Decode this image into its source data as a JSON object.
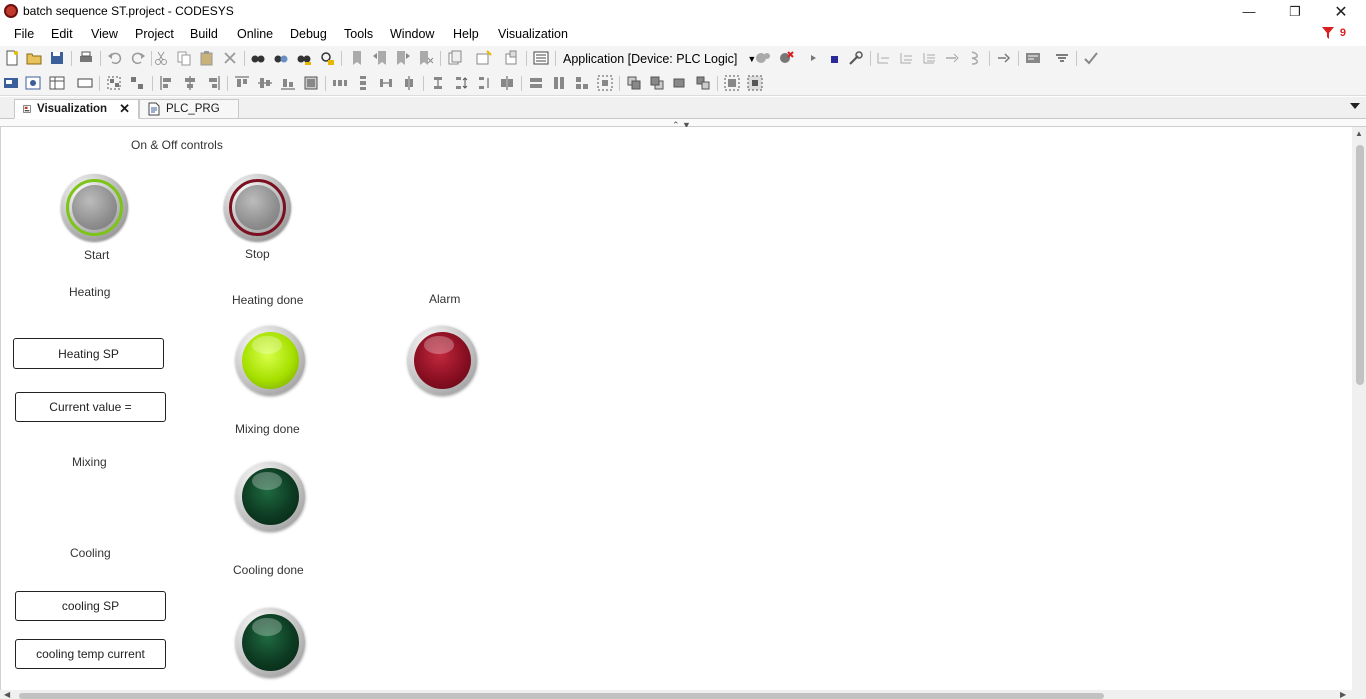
{
  "window": {
    "title": "batch sequence ST.project - CODESYS"
  },
  "menu": [
    "File",
    "Edit",
    "View",
    "Project",
    "Build",
    "Online",
    "Debug",
    "Tools",
    "Window",
    "Help",
    "Visualization"
  ],
  "alerts": {
    "count": "9"
  },
  "toolbar": {
    "application_combo": "Application [Device: PLC Logic]"
  },
  "tabs": [
    {
      "label": "Visualization",
      "active": true
    },
    {
      "label": "PLC_PRG",
      "active": false
    }
  ],
  "canvas": {
    "section_title": "On & Off controls",
    "start_label": "Start",
    "stop_label": "Stop",
    "heating_label": "Heating",
    "heating_sp": "Heating SP",
    "current_value": "Current value =",
    "mixing_label": "Mixing",
    "cooling_label": "Cooling",
    "cooling_sp": "cooling SP",
    "cooling_temp_current": "cooling temp current",
    "heating_done_label": "Heating done",
    "alarm_label": "Alarm",
    "mixing_done_label": "Mixing done",
    "cooling_done_label": "Cooling done"
  },
  "lamps": {
    "heating_done": {
      "color": "#a6e000",
      "state": "on"
    },
    "alarm": {
      "color": "#8a0f22",
      "state": "on"
    },
    "mixing_done": {
      "color": "#0d3b22",
      "state": "off"
    },
    "cooling_done": {
      "color": "#0d3b22",
      "state": "off"
    }
  },
  "buttons": {
    "start_ring_color": "#7cc418",
    "stop_ring_color": "#7a1020"
  }
}
